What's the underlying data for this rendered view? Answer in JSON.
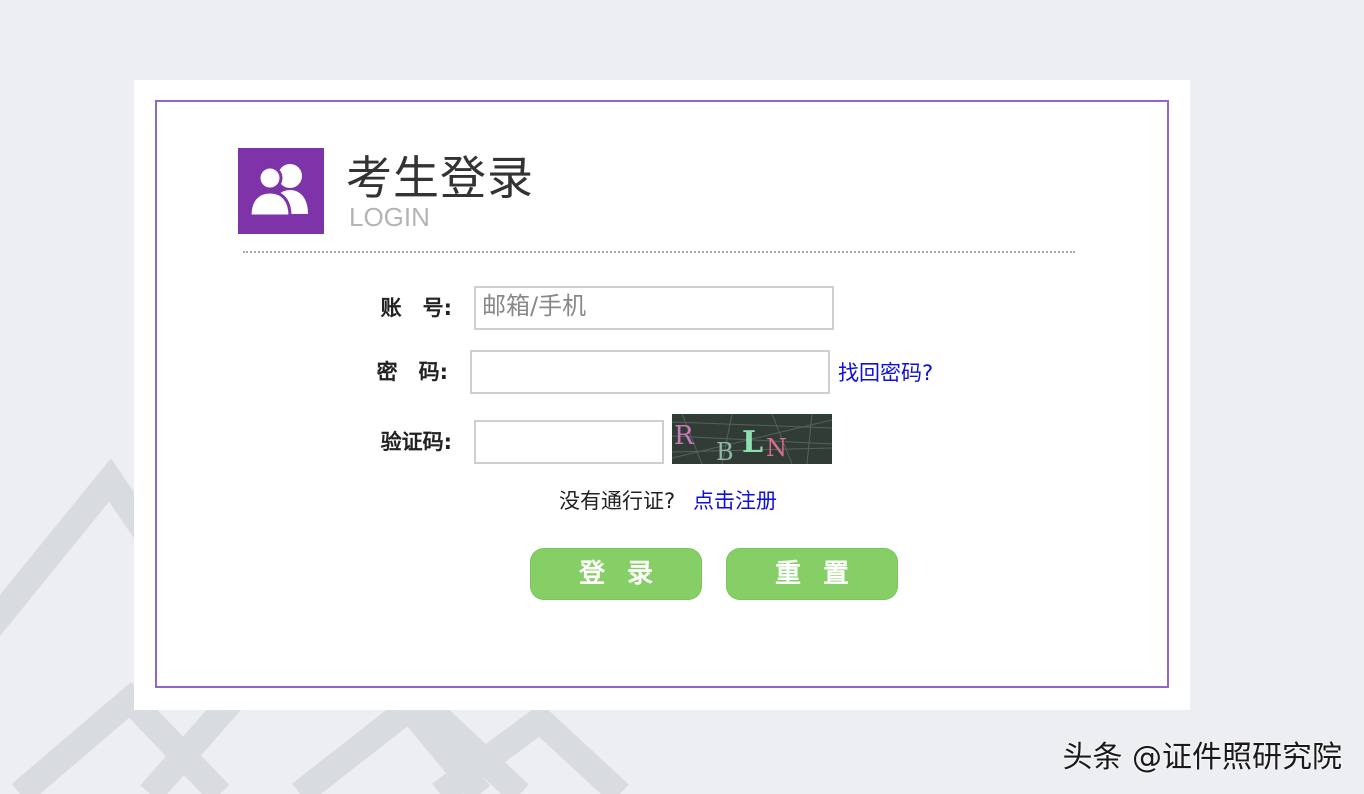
{
  "header": {
    "title": "考生登录",
    "subtitle": "LOGIN",
    "icon": "users-icon",
    "accent_color": "#7e33a8"
  },
  "form": {
    "account_label": "账　号:",
    "account_placeholder": "邮箱/手机",
    "password_label": "密　码:",
    "forgot_password_link": "找回密码?",
    "captcha_label": "验证码:",
    "captcha_text": "RBLN",
    "no_pass_text": "没有通行证?",
    "register_link": "点击注册",
    "login_button": "登录",
    "reset_button": "重置",
    "button_color": "#86cf66",
    "link_color": "#1010d8"
  },
  "watermark": {
    "text": "头条 @证件照研究院"
  }
}
